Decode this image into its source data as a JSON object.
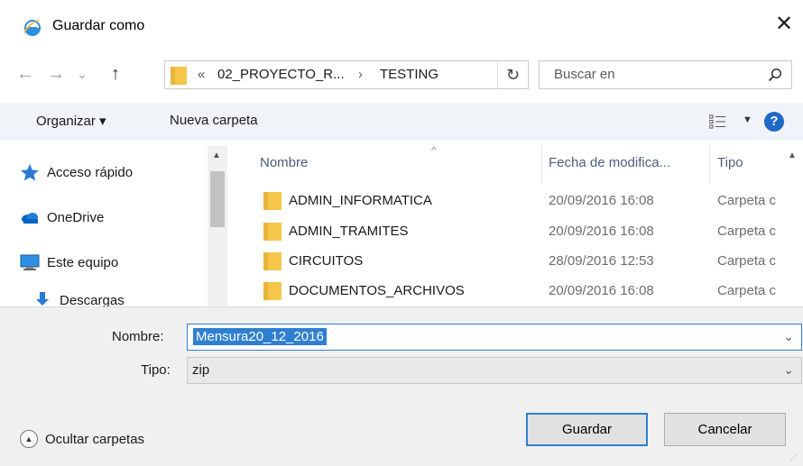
{
  "window": {
    "title": "Guardar como",
    "close_label": "✕"
  },
  "nav": {
    "back_label": "←",
    "forward_label": "→",
    "recent_label": "⌄",
    "up_label": "↑",
    "breadcrumb_overflow": "«",
    "breadcrumb_parent": "02_PROYECTO_R...",
    "breadcrumb_sep": "›",
    "breadcrumb_current": "TESTING",
    "refresh_label": "↻",
    "search_placeholder": "Buscar en"
  },
  "toolbar": {
    "organize_label": "Organizar ▾",
    "new_folder_label": "Nueva carpeta",
    "view_caret": "▼",
    "help_label": "?"
  },
  "sidebar": {
    "items": [
      {
        "label": "Acceso rápido",
        "icon": "star-icon"
      },
      {
        "label": "OneDrive",
        "icon": "cloud-icon"
      },
      {
        "label": "Este equipo",
        "icon": "computer-icon"
      },
      {
        "label": "Descargas",
        "icon": "download-icon"
      }
    ]
  },
  "filelist": {
    "columns": {
      "name": "Nombre",
      "date": "Fecha de modifica...",
      "type": "Tipo"
    },
    "rows": [
      {
        "name": "ADMIN_INFORMATICA",
        "date": "20/09/2016 16:08",
        "type": "Carpeta c"
      },
      {
        "name": "ADMIN_TRAMITES",
        "date": "20/09/2016 16:08",
        "type": "Carpeta c"
      },
      {
        "name": "CIRCUITOS",
        "date": "28/09/2016 12:53",
        "type": "Carpeta c"
      },
      {
        "name": "DOCUMENTOS_ARCHIVOS",
        "date": "20/09/2016 16:08",
        "type": "Carpeta c"
      }
    ]
  },
  "form": {
    "name_label": "Nombre:",
    "name_value": "Mensura20_12_2016",
    "type_label": "Tipo:",
    "type_value": "zip",
    "dropdown_glyph": "⌄"
  },
  "footer": {
    "hide_folders_label": "Ocultar carpetas",
    "save_label": "Guardar",
    "cancel_label": "Cancelar"
  },
  "colors": {
    "accent": "#2f7fd1",
    "folder": "#f5c64a",
    "toolbar_bg": "#f0f3f8",
    "bottom_bg": "#f0f0f0"
  }
}
